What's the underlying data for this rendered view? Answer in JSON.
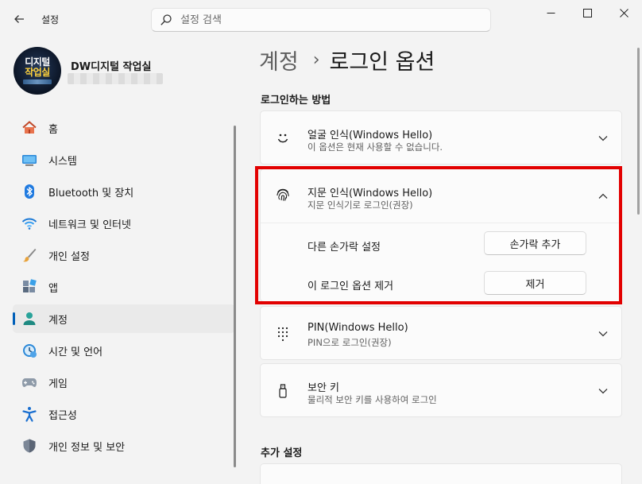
{
  "app": {
    "title": "설정"
  },
  "search": {
    "placeholder": "설정 검색"
  },
  "profile": {
    "name": "DW디지털 작업실",
    "avatar_line1": "디지털",
    "avatar_line2": "작업실"
  },
  "nav": {
    "items": [
      {
        "label": "홈",
        "icon": "home-icon"
      },
      {
        "label": "시스템",
        "icon": "system-icon"
      },
      {
        "label": "Bluetooth 및 장치",
        "icon": "bluetooth-icon"
      },
      {
        "label": "네트워크 및 인터넷",
        "icon": "wifi-icon"
      },
      {
        "label": "개인 설정",
        "icon": "brush-icon"
      },
      {
        "label": "앱",
        "icon": "apps-icon"
      },
      {
        "label": "계정",
        "icon": "account-icon",
        "active": true
      },
      {
        "label": "시간 및 언어",
        "icon": "clock-icon"
      },
      {
        "label": "게임",
        "icon": "gamepad-icon"
      },
      {
        "label": "접근성",
        "icon": "accessibility-icon"
      },
      {
        "label": "개인 정보 및 보안",
        "icon": "shield-icon"
      }
    ]
  },
  "breadcrumb": {
    "parent": "계정",
    "separator": "›",
    "current": "로그인 옵션"
  },
  "signin": {
    "section_title": "로그인하는 방법",
    "face": {
      "title": "얼굴 인식(Windows Hello)",
      "subtitle": "이 옵션은 현재 사용할 수 없습니다."
    },
    "fingerprint": {
      "title": "지문 인식(Windows Hello)",
      "subtitle": "지문 인식기로 로그인(권장)",
      "other_finger_label": "다른 손가락 설정",
      "add_finger_button": "손가락 추가",
      "remove_label": "이 로그인 옵션 제거",
      "remove_button": "제거"
    },
    "pin": {
      "title": "PIN(Windows Hello)",
      "subtitle": "PIN으로 로그인(권장)"
    },
    "security_key": {
      "title": "보안 키",
      "subtitle": "물리적 보안 키를 사용하여 로그인"
    }
  },
  "additional": {
    "section_title": "추가 설정"
  },
  "colors": {
    "accent": "#005fb8",
    "highlight": "#e20000"
  }
}
